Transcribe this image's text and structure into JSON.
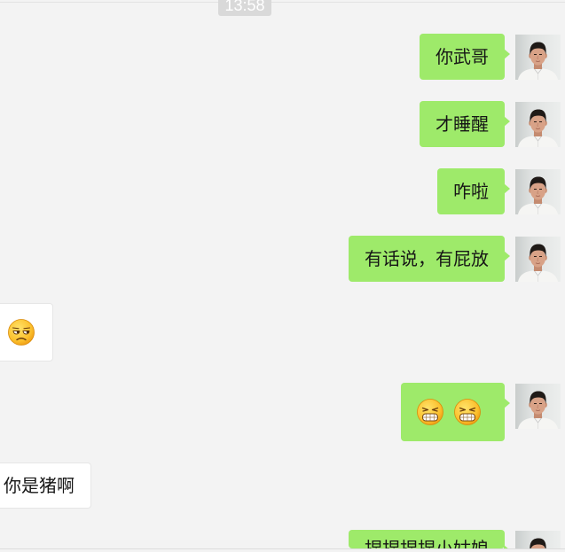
{
  "timestamp": "13:58",
  "colors": {
    "background": "#f3f3f3",
    "sent_bubble": "#9eea6a",
    "received_bubble": "#ffffff",
    "timestamp_badge": "#d9d9d9"
  },
  "messages": [
    {
      "outgoing": true,
      "text": "你武哥"
    },
    {
      "outgoing": true,
      "text": "才睡醒"
    },
    {
      "outgoing": true,
      "text": "咋啦"
    },
    {
      "outgoing": true,
      "text": "有话说，有屁放"
    },
    {
      "outgoing": false,
      "emoji": [
        "unamused-face-icon"
      ]
    },
    {
      "outgoing": true,
      "emoji": [
        "grinning-face-icon",
        "grinning-face-icon"
      ]
    },
    {
      "outgoing": false,
      "text": "你是猪啊"
    },
    {
      "outgoing": true,
      "text": "捏捏捏捏小姑娘"
    }
  ]
}
